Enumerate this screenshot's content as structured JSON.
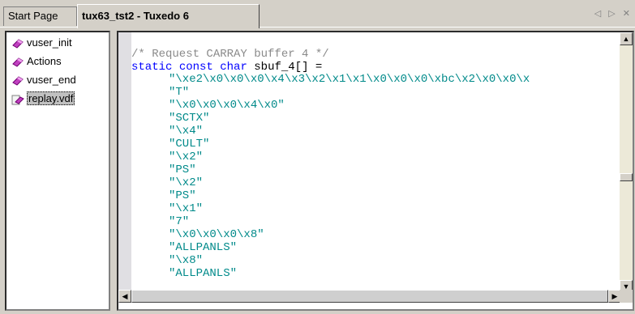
{
  "tabs": [
    {
      "label": "Start Page"
    },
    {
      "label": "tux63_tst2 - Tuxedo 6"
    }
  ],
  "nav": {
    "prev": "◁",
    "next": "▷",
    "close": "✕"
  },
  "tree": {
    "items": [
      {
        "label": "vuser_init",
        "icon": "script-gem-icon"
      },
      {
        "label": "Actions",
        "icon": "script-gem-icon"
      },
      {
        "label": "vuser_end",
        "icon": "script-gem-icon"
      },
      {
        "label": "replay.vdf",
        "icon": "data-file-gem-icon",
        "selected": true
      }
    ]
  },
  "code": {
    "comment": "/* Request CARRAY buffer 4 */",
    "kw1": "static",
    "kw2": "const",
    "kw3": "char",
    "decl_rest": " sbuf_4[] =",
    "lines": [
      "\"\\xe2\\x0\\x0\\x0\\x4\\x3\\x2\\x1\\x1\\x0\\x0\\x0\\xbc\\x2\\x0\\x0\\x",
      "\"T\"",
      "\"\\x0\\x0\\x0\\x4\\x0\"",
      "\"SCTX\"",
      "\"\\x4\"",
      "\"CULT\"",
      "\"\\x2\"",
      "\"PS\"",
      "\"\\x2\"",
      "\"PS\"",
      "\"\\x1\"",
      "\"7\"",
      "\"\\x0\\x0\\x0\\x8\"",
      "\"ALLPANLS\"",
      "\"\\x8\"",
      "\"ALLPANLS\""
    ]
  },
  "colors": {
    "comment": "#8a8a8a",
    "keyword": "#0000ff",
    "string": "#008a8a"
  }
}
